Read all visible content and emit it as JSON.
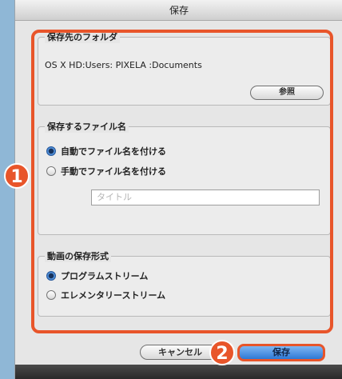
{
  "dialog": {
    "title": "保存"
  },
  "folder_group": {
    "title": "保存先のフォルダ",
    "path": "OS X HD:Users: PIXELA :Documents",
    "browse_label": "参照"
  },
  "filename_group": {
    "title": "保存するファイル名",
    "auto_label": "自動でファイル名を付ける",
    "manual_label": "手動でファイル名を付ける",
    "name_placeholder": "タイトル",
    "selected": "auto"
  },
  "format_group": {
    "title": "動画の保存形式",
    "program_label": "プログラムストリーム",
    "elementary_label": "エレメンタリーストリーム",
    "selected": "program"
  },
  "buttons": {
    "cancel_label": "キャンセル",
    "save_label": "保存"
  },
  "callouts": {
    "badge1": "1",
    "badge2": "2",
    "accent_color": "#e8552a"
  }
}
